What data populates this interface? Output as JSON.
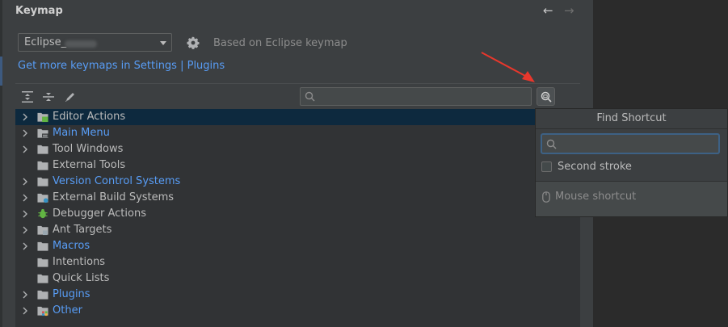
{
  "header": {
    "title": "Keymap",
    "nav": {
      "back_icon": "arrow-left-icon",
      "forward_icon": "arrow-right-icon"
    }
  },
  "keymap": {
    "selected": "Eclipse_",
    "based_on": "Based on Eclipse keymap"
  },
  "links": {
    "more_keymaps": "Get more keymaps in Settings | Plugins"
  },
  "toolbar": {
    "expand_all_icon": "expand-all-icon",
    "collapse_all_icon": "collapse-all-icon",
    "edit_icon": "pencil-icon",
    "search_placeholder": "",
    "find_shortcut_icon": "find-shortcut-icon"
  },
  "tree": {
    "items": [
      {
        "label": "Editor Actions",
        "expandable": true,
        "modified": false
      },
      {
        "label": "Main Menu",
        "expandable": true,
        "modified": true
      },
      {
        "label": "Tool Windows",
        "expandable": true,
        "modified": false
      },
      {
        "label": "External Tools",
        "expandable": false,
        "modified": false
      },
      {
        "label": "Version Control Systems",
        "expandable": true,
        "modified": true
      },
      {
        "label": "External Build Systems",
        "expandable": true,
        "modified": false
      },
      {
        "label": "Debugger Actions",
        "expandable": true,
        "modified": false
      },
      {
        "label": "Ant Targets",
        "expandable": true,
        "modified": false
      },
      {
        "label": "Macros",
        "expandable": true,
        "modified": true
      },
      {
        "label": "Intentions",
        "expandable": false,
        "modified": false
      },
      {
        "label": "Quick Lists",
        "expandable": false,
        "modified": false
      },
      {
        "label": "Plugins",
        "expandable": true,
        "modified": true
      },
      {
        "label": "Other",
        "expandable": true,
        "modified": true
      }
    ]
  },
  "find_shortcut_popup": {
    "title": "Find Shortcut",
    "input_value": "",
    "second_stroke_label": "Second stroke",
    "second_stroke_checked": false,
    "mouse_shortcut_label": "Mouse shortcut"
  },
  "colors": {
    "accent": "#589df6",
    "selection": "#0d293e",
    "annotation_arrow": "#e8372c"
  }
}
